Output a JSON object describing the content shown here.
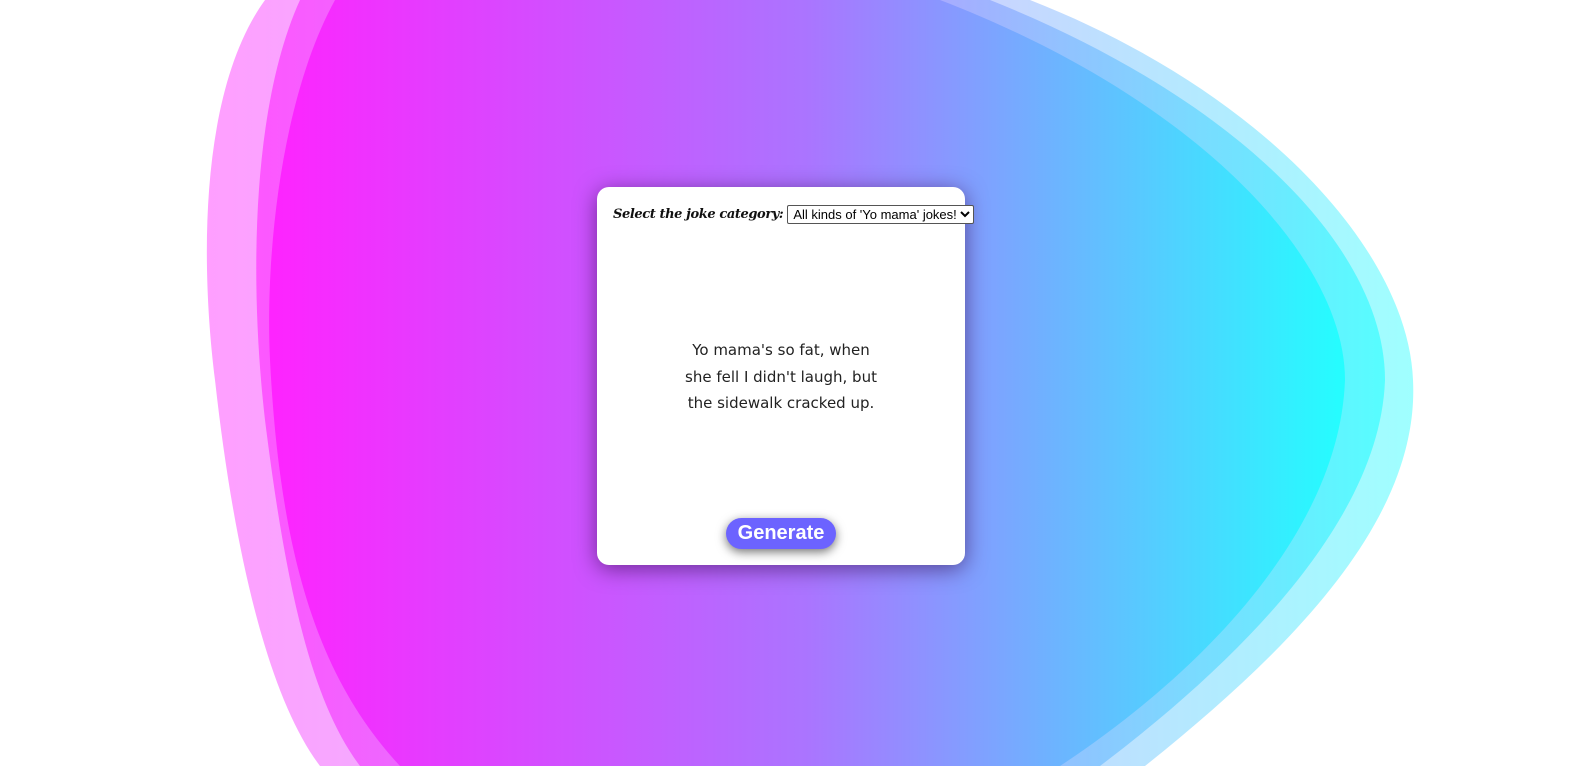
{
  "background": {
    "gradient_start": "#ff1aff",
    "gradient_mid": "#a76fff",
    "gradient_end": "#1affff"
  },
  "card": {
    "category_label": "Select the joke category:",
    "category_select": {
      "selected": "All kinds of 'Yo mama' jokes!"
    },
    "joke_text": "Yo mama's so fat, when she fell I didn't laugh, but the sidewalk cracked up.",
    "generate_label": "Generate"
  },
  "colors": {
    "button": "#6c63ff",
    "card": "#ffffff"
  }
}
